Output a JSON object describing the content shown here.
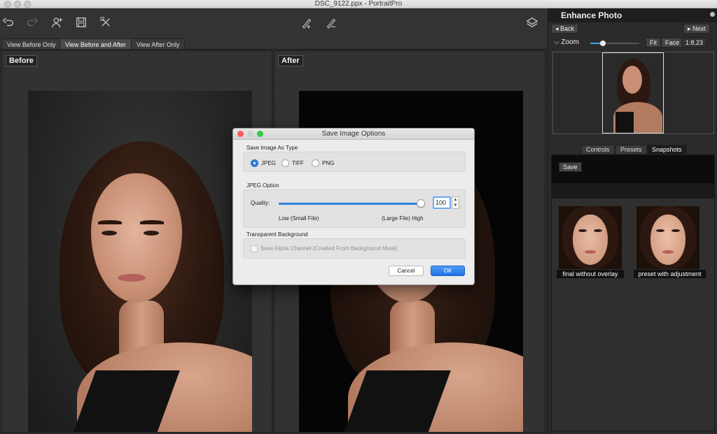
{
  "window": {
    "title": "DSC_9122.ppx - PortraitPro"
  },
  "toolbar": {
    "icons": [
      "undo-icon",
      "redo-icon",
      "add-person-icon",
      "save-icon",
      "close-image-icon",
      "brush-add-icon",
      "brush-subtract-icon",
      "layers-icon"
    ]
  },
  "view_tabs": [
    {
      "label": "View Before Only"
    },
    {
      "label": "View Before and After"
    },
    {
      "label": "View After Only"
    }
  ],
  "panels": {
    "before_label": "Before",
    "after_label": "After"
  },
  "sidebar": {
    "title": "Enhance Photo",
    "back_label": "Back",
    "next_label": "Next",
    "zoom_label": "Zoom",
    "zoom_level": 0.25,
    "fit_label": "Fit",
    "face_label": "Face",
    "zoom_value": "1:8.23",
    "tabs": [
      {
        "label": "Controls"
      },
      {
        "label": "Presets"
      },
      {
        "label": "Snapshots"
      }
    ],
    "save_label": "Save",
    "snapshots": [
      {
        "caption": "final without overlay"
      },
      {
        "caption": "preset with adjustment"
      }
    ]
  },
  "dialog": {
    "title": "Save Image Options",
    "type_section": "Save Image As Type",
    "types": [
      {
        "label": "JPEG",
        "checked": true
      },
      {
        "label": "TIFF",
        "checked": false
      },
      {
        "label": "PNG",
        "checked": false
      }
    ],
    "jpeg_section": "JPEG Option",
    "quality_label": "Quality:",
    "quality_value": "100",
    "quality_fraction": 1.0,
    "low_hint": "Low (Small File)",
    "high_hint": "(Large File) High",
    "transparent_section": "Transparent Background",
    "alpha_label": "Save Alpha Channel (Created From Background Mask)",
    "cancel_label": "Cancel",
    "ok_label": "OK"
  },
  "colors": {
    "accent": "#2f7fe0",
    "close_dot": "#fc5b57",
    "min_dot": "#cfcfcf",
    "max_dot": "#34c84a"
  }
}
